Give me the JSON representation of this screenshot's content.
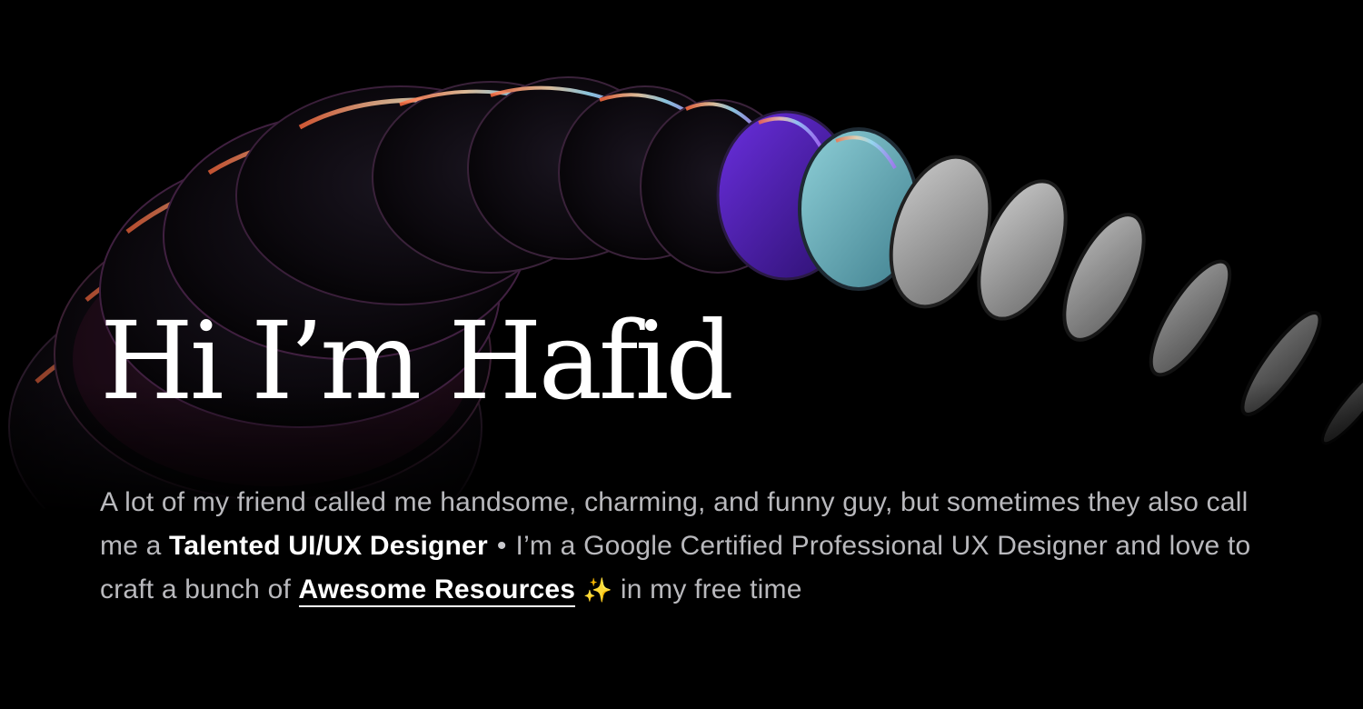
{
  "hero": {
    "headline": "Hi I’m Hafid",
    "intro": {
      "line1_text": "A lot of my friend called me handsome, charming, and funny guy, but sometimes they also call me a ",
      "highlight": "Talented UI/UX Designer",
      "separator": "•",
      "line2_text": "I’m a Google Certified Professional UX Designer and love to craft a bunch of ",
      "link_label": "Awesome Resources",
      "sparkle_icon": "✨",
      "tail_text": " in my free time"
    }
  },
  "colors": {
    "background": "#000000",
    "headline": "#ffffff",
    "body_text": "#b9b9bd",
    "emphasis": "#ffffff"
  }
}
